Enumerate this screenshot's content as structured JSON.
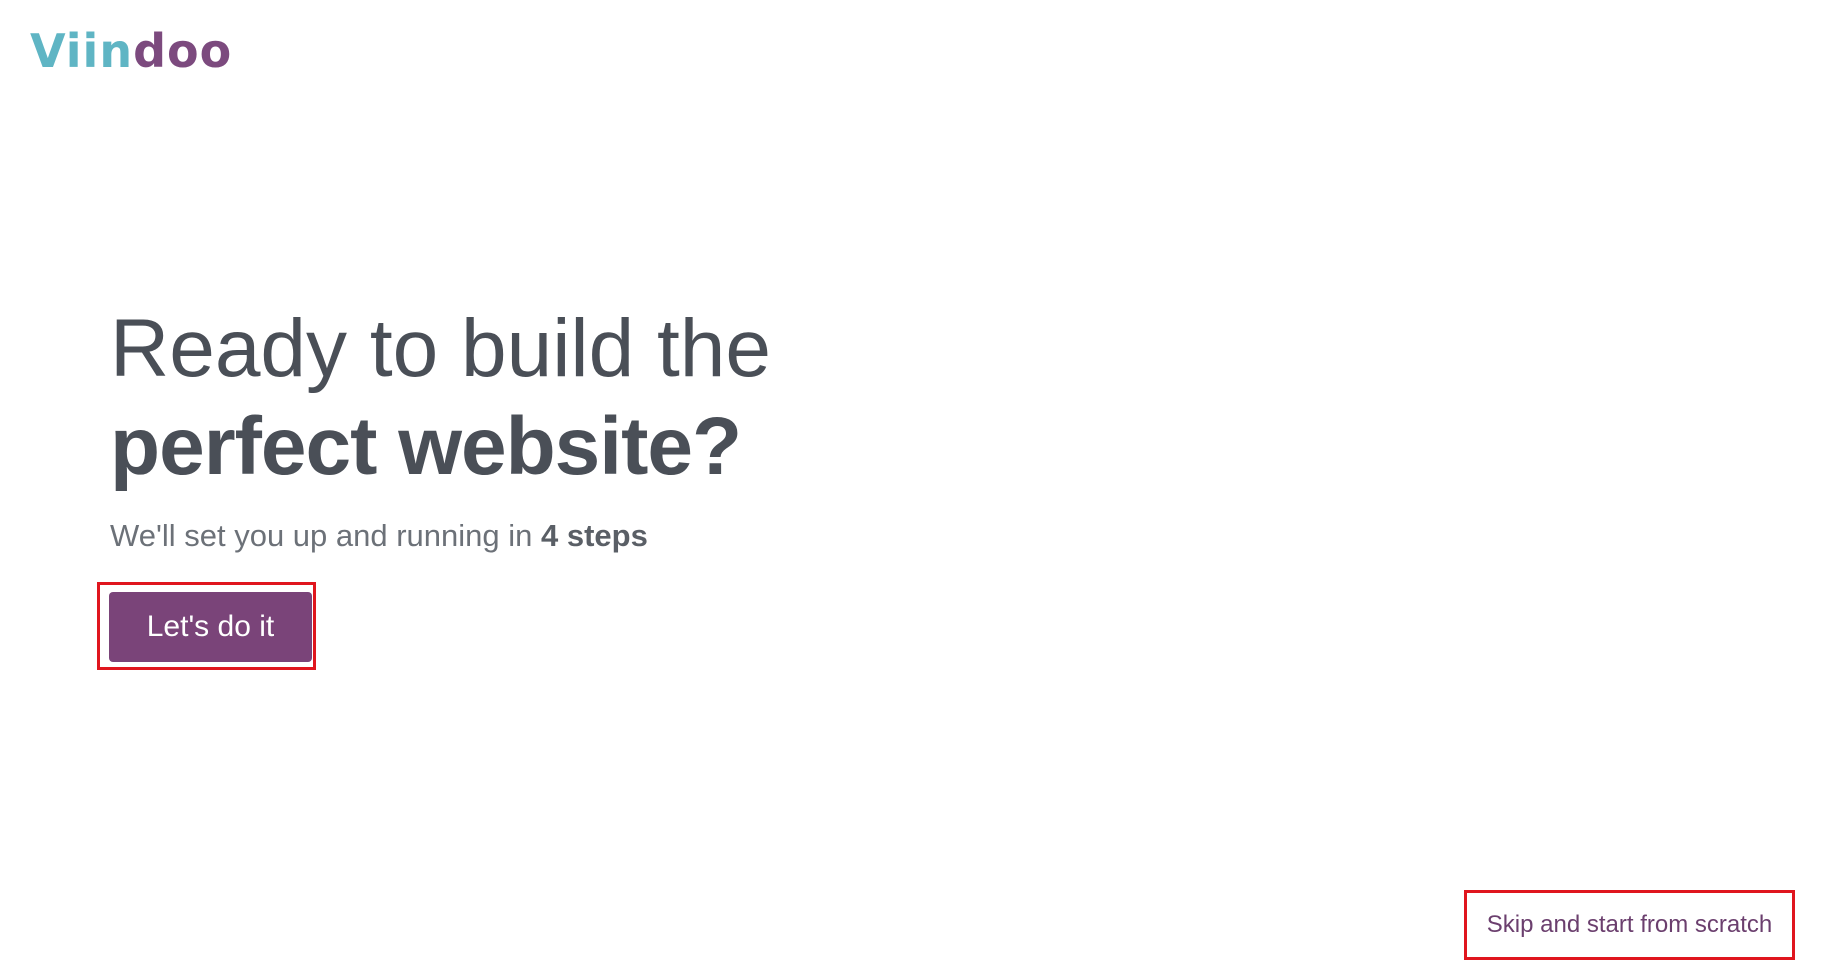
{
  "logo": {
    "part_a": "Viin",
    "part_b": "doo",
    "color_a": "#5fb5c4",
    "color_b": "#7c4a7e"
  },
  "hero": {
    "title_line1": "Ready to build the",
    "title_line2": "perfect website?",
    "subtitle_prefix": "We'll set you up and running in ",
    "subtitle_steps": "4 steps"
  },
  "actions": {
    "primary_label": "Let's do it",
    "skip_label": "Skip and start from scratch"
  },
  "colors": {
    "primary": "#7a4479",
    "text": "#4a4f57",
    "highlight_frame": "#e0161e"
  }
}
